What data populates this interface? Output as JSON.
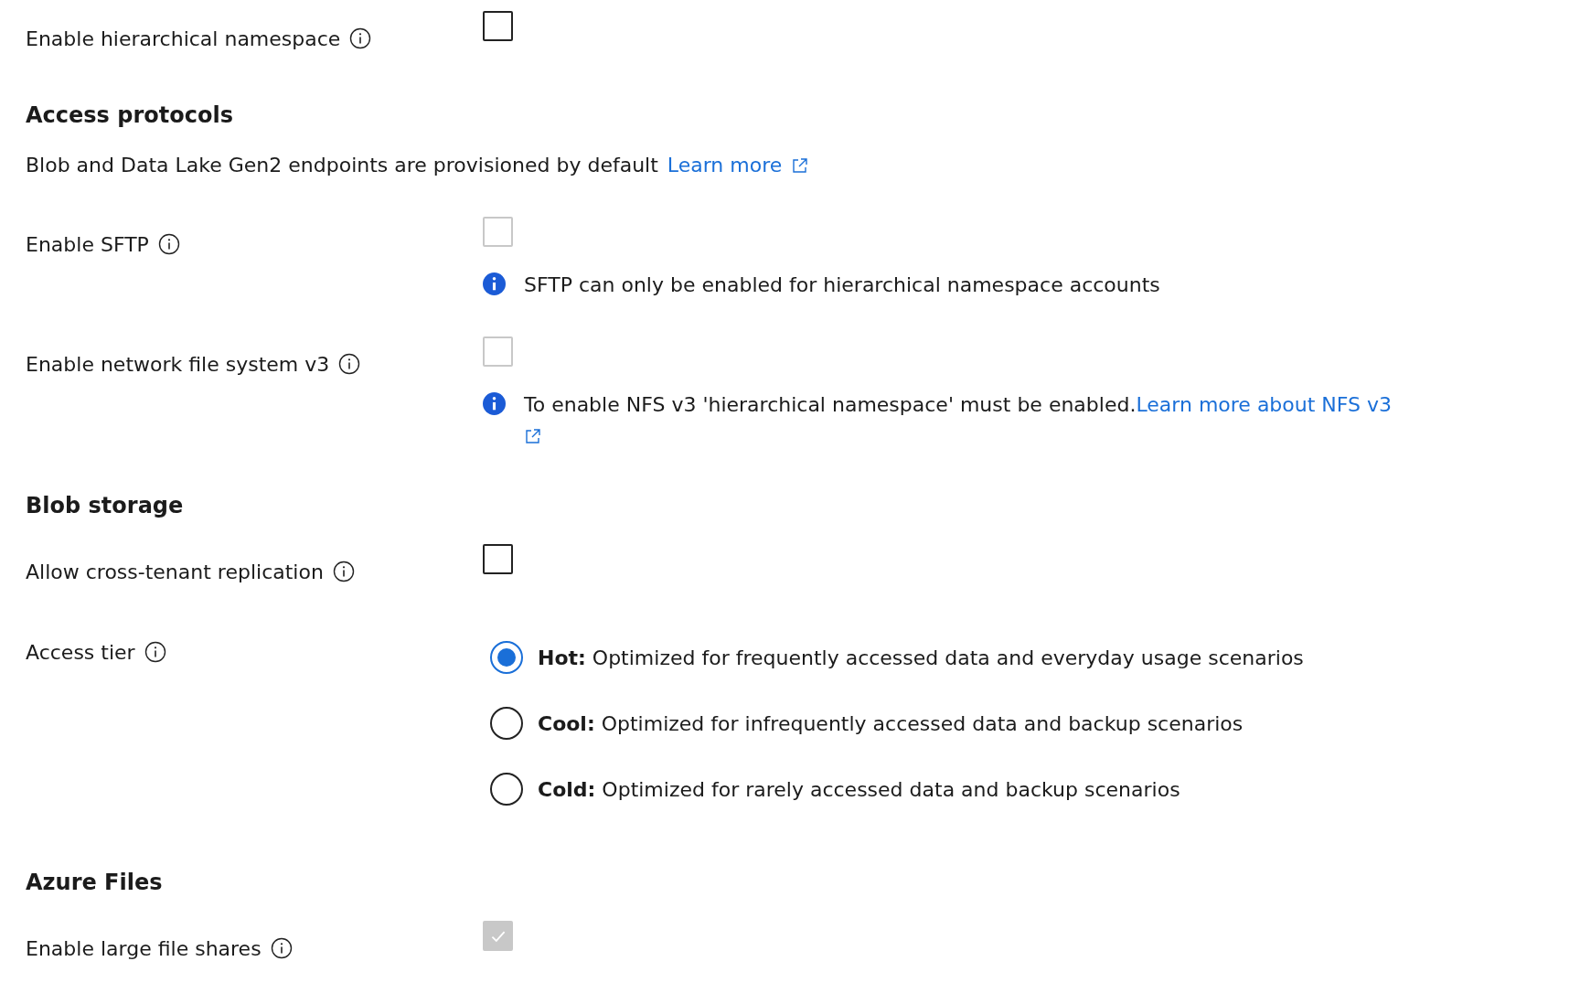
{
  "rows": [
    {
      "kind": "checkbox",
      "label": "Enable hierarchical namespace",
      "checked": false,
      "disabled": false
    },
    {
      "kind": "heading",
      "text": "Access protocols"
    },
    {
      "kind": "text",
      "text": "Blob and Data Lake Gen2 endpoints are provisioned by default",
      "link": "Learn more"
    },
    {
      "kind": "checkbox",
      "label": "Enable SFTP",
      "checked": false,
      "disabled": true,
      "note": "SFTP can only be enabled for hierarchical namespace accounts"
    },
    {
      "kind": "checkbox",
      "label": "Enable network file system v3",
      "checked": false,
      "disabled": true,
      "note": "To enable NFS v3 'hierarchical namespace' must be enabled.",
      "note_link": "Learn more about NFS v3"
    },
    {
      "kind": "heading",
      "text": "Blob storage"
    },
    {
      "kind": "checkbox",
      "label": "Allow cross-tenant replication",
      "checked": false,
      "disabled": false
    },
    {
      "kind": "radio",
      "label": "Access tier",
      "options": [
        {
          "text": "**Hot:** Optimized for frequently accessed data and everyday usage scenarios",
          "selected": true
        },
        {
          "text": "**Cool:** Optimized for infrequently accessed data and backup scenarios",
          "selected": false
        },
        {
          "text": "**Cold:** Optimized for rarely accessed data and backup scenarios",
          "selected": false
        }
      ]
    },
    {
      "kind": "heading",
      "text": "Azure Files"
    },
    {
      "kind": "checkbox",
      "label": "Enable large file shares",
      "checked": true,
      "disabled": true
    }
  ]
}
